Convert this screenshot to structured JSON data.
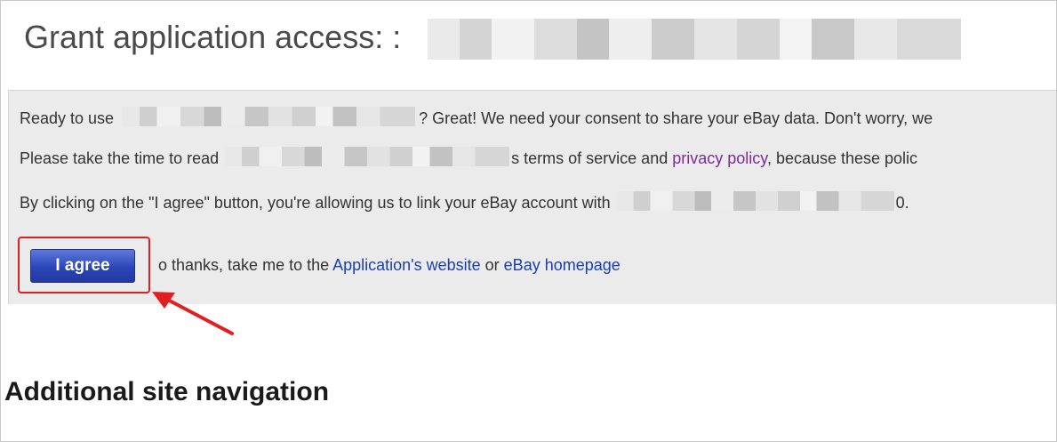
{
  "page": {
    "title": "Grant application access: :"
  },
  "consent": {
    "line1_prefix": "Ready to use",
    "line1_suffix": "? Great! We need your consent to share your eBay data. Don't worry, we",
    "line2_prefix": "Please take the time to read",
    "line2_mid": "s terms of service and ",
    "line2_link": "privacy policy",
    "line2_suffix": ", because these polic",
    "line3_prefix": "By clicking on the \"I agree\" button, you're allowing us to link your eBay account with",
    "line3_suffix": "0."
  },
  "actions": {
    "agree_label": "I agree",
    "decline_prefix": "o thanks, take me to the ",
    "app_link": "Application's website",
    "or_text": " or ",
    "ebay_link": "eBay homepage"
  },
  "footer": {
    "heading": "Additional site navigation"
  },
  "colors": {
    "annotation": "#e02020",
    "link": "#1a3fb0",
    "visited_link": "#7b2b9a",
    "button": "#2b46b8"
  },
  "icons": {
    "annotation_arrow": "red-arrow-icon"
  }
}
